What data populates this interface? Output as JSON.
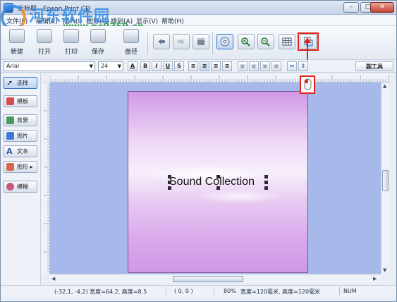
{
  "window": {
    "title": "无标题 - Epson Print CD"
  },
  "watermark": {
    "title": "河东软件园",
    "url": "www.pc0359.cn"
  },
  "menu": [
    "文件(F)",
    "编辑(E)",
    "插入(I)",
    "图形(G)",
    "排列(A)",
    "显示(V)",
    "帮助(H)"
  ],
  "toolbar": {
    "new": "新建",
    "open": "打开",
    "print": "打印",
    "save": "保存",
    "disc": "盘径"
  },
  "format": {
    "font": "Arial",
    "size": "24",
    "insert": "副工具"
  },
  "side": [
    "选择",
    "模板",
    "背景",
    "图片",
    "文本",
    "图形 ▸",
    "模糊"
  ],
  "canvas": {
    "text": "Sound Collection"
  },
  "status": {
    "pos": "(-32.1, -4.2) 宽度=64.2, 高度=8.5",
    "origin": "( 0, 0 )",
    "zoom": "80%",
    "size": "宽度=120毫米, 高度=120毫米",
    "num": "NUM"
  },
  "colors": {
    "highlight": "#e0231a",
    "canvas": "#a7b9ea"
  }
}
